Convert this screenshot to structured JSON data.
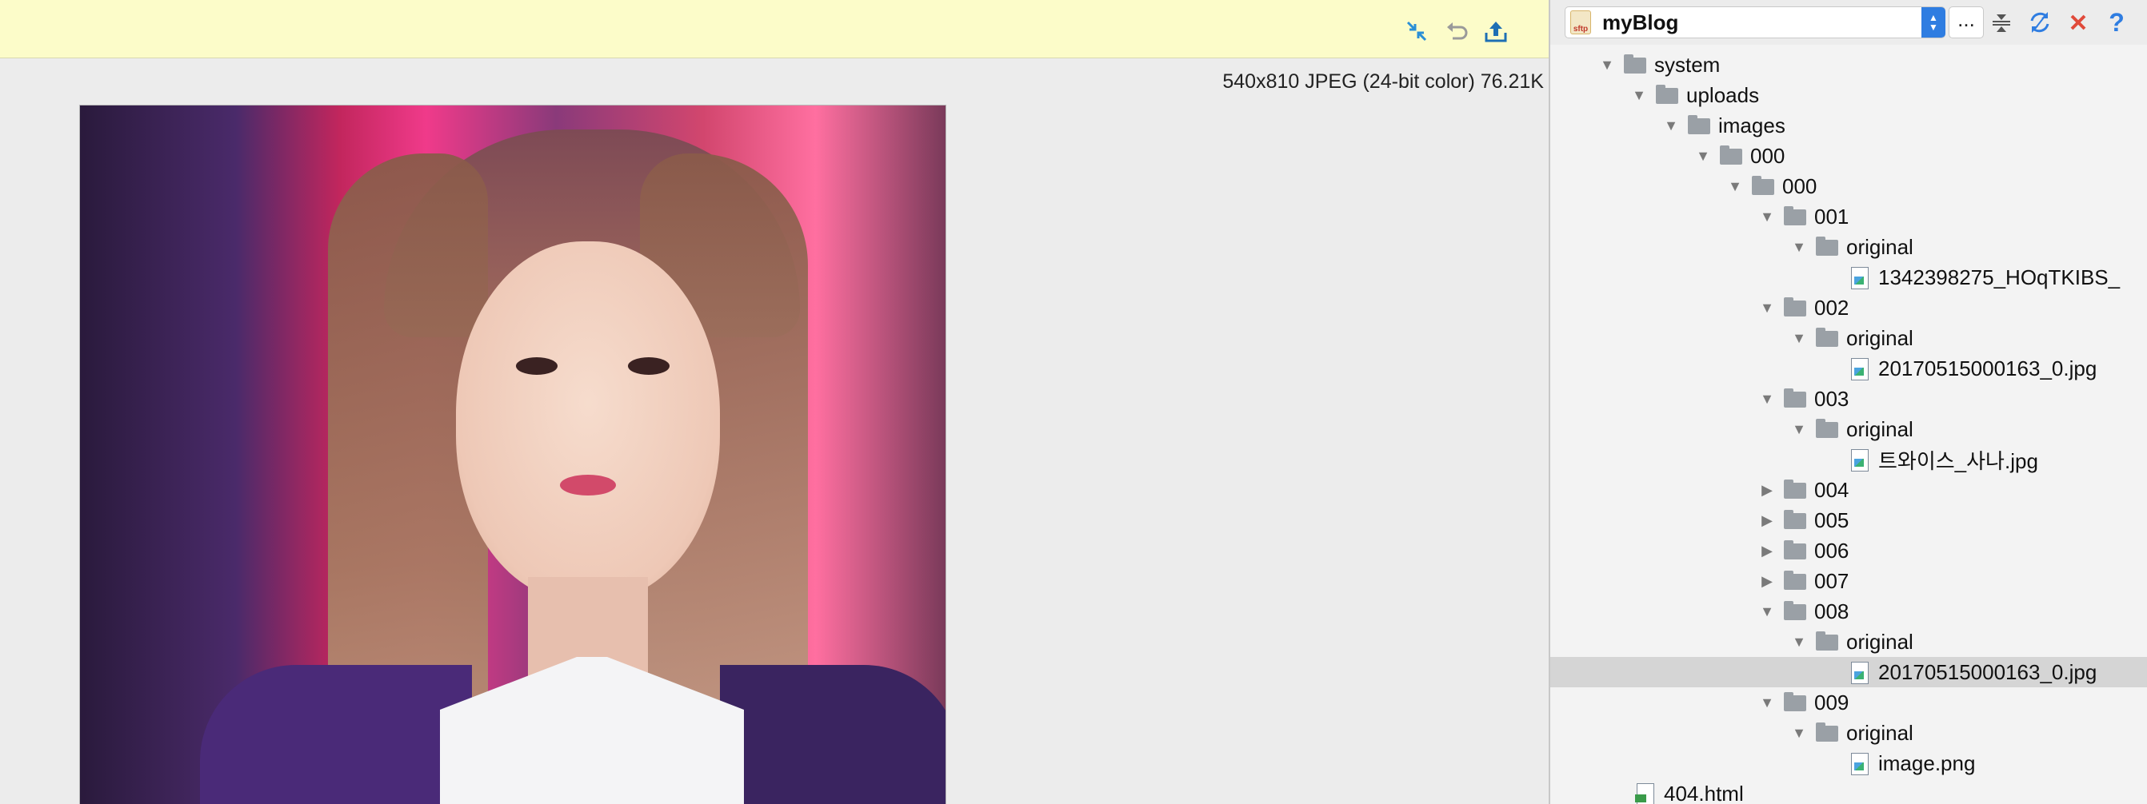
{
  "viewer": {
    "image_info": "540x810 JPEG (24-bit color) 76.21K",
    "toolbar": {
      "icons": [
        "collapse-arrows-icon",
        "undo-icon",
        "upload-icon"
      ]
    }
  },
  "sftp": {
    "connection_name": "myBlog",
    "badge_text": "sftp",
    "more_label": "...",
    "toolbar_icons": [
      "collapse-all-icon",
      "sync-icon",
      "close-icon",
      "help-icon"
    ]
  },
  "tree": {
    "rows": [
      {
        "label": "system",
        "type": "folder",
        "depth": 0,
        "expanded": true,
        "selected": false
      },
      {
        "label": "uploads",
        "type": "folder",
        "depth": 1,
        "expanded": true,
        "selected": false
      },
      {
        "label": "images",
        "type": "folder",
        "depth": 2,
        "expanded": true,
        "selected": false
      },
      {
        "label": "000",
        "type": "folder",
        "depth": 3,
        "expanded": true,
        "selected": false
      },
      {
        "label": "000",
        "type": "folder",
        "depth": 4,
        "expanded": true,
        "selected": false
      },
      {
        "label": "001",
        "type": "folder",
        "depth": 5,
        "expanded": true,
        "selected": false
      },
      {
        "label": "original",
        "type": "folder",
        "depth": 6,
        "expanded": true,
        "selected": false
      },
      {
        "label": "1342398275_HOqTKIBS_",
        "type": "image",
        "depth": 7,
        "selected": false
      },
      {
        "label": "002",
        "type": "folder",
        "depth": 5,
        "expanded": true,
        "selected": false
      },
      {
        "label": "original",
        "type": "folder",
        "depth": 6,
        "expanded": true,
        "selected": false
      },
      {
        "label": "20170515000163_0.jpg",
        "type": "image",
        "depth": 7,
        "selected": false
      },
      {
        "label": "003",
        "type": "folder",
        "depth": 5,
        "expanded": true,
        "selected": false
      },
      {
        "label": "original",
        "type": "folder",
        "depth": 6,
        "expanded": true,
        "selected": false
      },
      {
        "label": "트와이스_사나.jpg",
        "type": "image",
        "depth": 7,
        "selected": false
      },
      {
        "label": "004",
        "type": "folder",
        "depth": 5,
        "expanded": false,
        "selected": false
      },
      {
        "label": "005",
        "type": "folder",
        "depth": 5,
        "expanded": false,
        "selected": false
      },
      {
        "label": "006",
        "type": "folder",
        "depth": 5,
        "expanded": false,
        "selected": false
      },
      {
        "label": "007",
        "type": "folder",
        "depth": 5,
        "expanded": false,
        "selected": false
      },
      {
        "label": "008",
        "type": "folder",
        "depth": 5,
        "expanded": true,
        "selected": false
      },
      {
        "label": "original",
        "type": "folder",
        "depth": 6,
        "expanded": true,
        "selected": false
      },
      {
        "label": "20170515000163_0.jpg",
        "type": "image",
        "depth": 7,
        "selected": true
      },
      {
        "label": "009",
        "type": "folder",
        "depth": 5,
        "expanded": true,
        "selected": false
      },
      {
        "label": "original",
        "type": "folder",
        "depth": 6,
        "expanded": true,
        "selected": false
      },
      {
        "label": "image.png",
        "type": "image",
        "depth": 7,
        "selected": false
      },
      {
        "label": "404.html",
        "type": "html",
        "depth": 0,
        "selected": false
      }
    ]
  },
  "colors": {
    "notification_bg": "#fcfcc9",
    "accent": "#2f7de1",
    "selected_row": "#d5d5d5",
    "close_red": "#e04a3a"
  }
}
